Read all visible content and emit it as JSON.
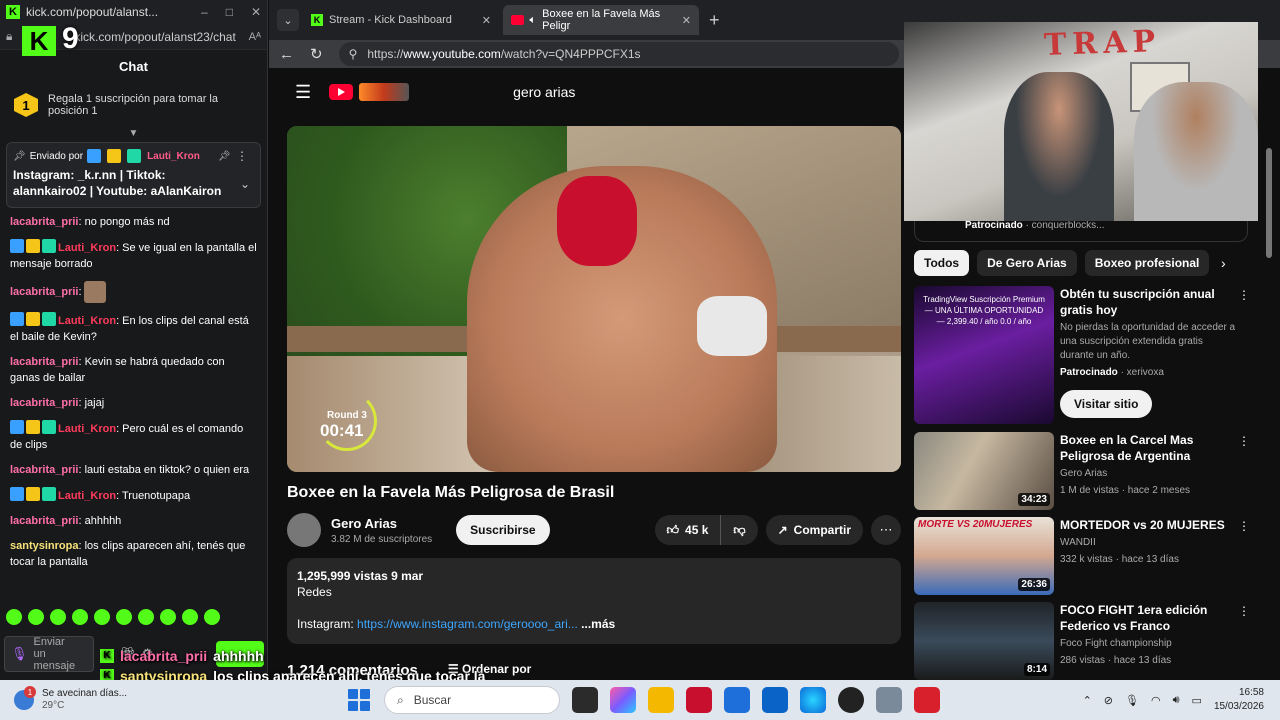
{
  "chat_window": {
    "title": "kick.com/popout/alanst...",
    "url": "kick.com/popout/alanst23/chat",
    "overlay_number": "9",
    "header": "Chat",
    "goal_rank": "1",
    "goal_text": "Regala 1 suscripción para tomar la posición 1",
    "pinned": {
      "sent_by_label": "Enviado por",
      "author": "Lauti_Kron",
      "message": "Instagram: _k.r.nn | Tiktok: alannkairo02 | Youtube: aAlanKairon"
    },
    "messages": [
      {
        "user": "lacabrita_prii",
        "text": ": no pongo más nd",
        "color": "pink",
        "badges": false
      },
      {
        "user": "Lauti_Kron",
        "text": ": Se ve igual en la pantalla el mensaje borrado",
        "color": "red",
        "badges": true
      },
      {
        "user": "lacabrita_prii",
        "text": ":",
        "color": "pink",
        "badges": false,
        "avatar": true
      },
      {
        "user": "Lauti_Kron",
        "text": ": En los clips del canal está el baile de Kevin?",
        "color": "red",
        "badges": true
      },
      {
        "user": "lacabrita_prii",
        "text": ": Kevin se habrá quedado con ganas de bailar",
        "color": "pink",
        "badges": false
      },
      {
        "user": "lacabrita_prii",
        "text": ": jajaj",
        "color": "pink",
        "badges": false
      },
      {
        "user": "Lauti_Kron",
        "text": ": Pero cuál es el comando de clips",
        "color": "red",
        "badges": true
      },
      {
        "user": "lacabrita_prii",
        "text": ": lauti estaba en tiktok? o quien era",
        "color": "pink",
        "badges": false
      },
      {
        "user": "Lauti_Kron",
        "text": ": Truenotupapa",
        "color": "red",
        "badges": true
      },
      {
        "user": "lacabrita_prii",
        "text": ": ahhhhh",
        "color": "pink",
        "badges": false
      },
      {
        "user": "santysinropa",
        "text": ": los clips aparecen ahí, tenés que tocar la pantalla",
        "color": "yellow",
        "badges": false
      }
    ],
    "input_placeholder": "Enviar un mensaje"
  },
  "browser": {
    "tabs": [
      {
        "label": "Stream - Kick Dashboard",
        "icon": "kick-icon"
      },
      {
        "label": "Boxee en la Favela Más Peligr",
        "icon": "youtube-icon"
      }
    ],
    "url_prefix": "https://",
    "url_host": "www.youtube.com",
    "url_path": "/watch?v=QN4PPPCFX1s"
  },
  "youtube": {
    "search_query": "gero arias",
    "video": {
      "round_label": "Round 3",
      "round_time": "00:41",
      "title": "Boxee en la Favela Más Peligrosa de Brasil",
      "channel": "Gero Arias",
      "subscribers": "3.82 M de suscriptores",
      "subscribe_label": "Suscribirse",
      "likes": "45 k",
      "share_label": "Compartir",
      "views_date": "1,295,999 vistas  9 mar",
      "desc_line2": "Redes",
      "desc_instagram_label": "Instagram:",
      "desc_instagram_link": "https://www.instagram.com/geroooo_ari...",
      "desc_more": "...más",
      "comments_partial": "1.214 comentarios",
      "sort_label": "Ordenar por"
    },
    "partial_row": {
      "label": "Patrocinado",
      "text": "· conquerblocks..."
    },
    "chips": [
      "Todos",
      "De Gero Arias",
      "Boxeo profesional"
    ],
    "recommendations": [
      {
        "title": "Obtén tu suscripción anual gratis hoy",
        "meta1": "No pierdas la oportunidad de acceder a una suscripción extendida gratis durante un año.",
        "meta2_label": "Patrocinado",
        "meta2_text": "· xerivoxa",
        "cta": "Visitar sitio",
        "thumb_text": "TradingView Suscripción Premium — UNA ÚLTIMA OPORTUNIDAD — 2,399.40 / año 0.0 / año",
        "duration": ""
      },
      {
        "title": "Boxee en la Carcel Mas Peligrosa de Argentina",
        "meta1": "Gero Arias",
        "meta2": "1 M de vistas · hace 2 meses",
        "duration": "34:23"
      },
      {
        "title": "MORTEDOR vs 20 MUJERES",
        "meta1": "WANDII",
        "meta2": "332 k vistas · hace 13 días",
        "duration": "26:36",
        "thumb_text": "MORTE VS 20MUJERES"
      },
      {
        "title": "FOCO FIGHT 1era edición Federico vs Franco",
        "meta1": "Foco Fight championship",
        "meta2": "286 vistas · hace 13 días",
        "duration": "8:14"
      }
    ]
  },
  "webcam": {
    "wall_text": "TRAP"
  },
  "stream_overlay": [
    {
      "user": "lacabrita_prii",
      "text": "ahhhhh"
    },
    {
      "user": "santysinropa",
      "text": "los clips aparecen ahí, tenés que tocar la",
      "cont": "pantalla"
    }
  ],
  "taskbar": {
    "weather_text": "Se avecinan días...",
    "temperature": "29°C",
    "search_placeholder": "Buscar",
    "time": "16:58",
    "date": "15/03/2026"
  }
}
